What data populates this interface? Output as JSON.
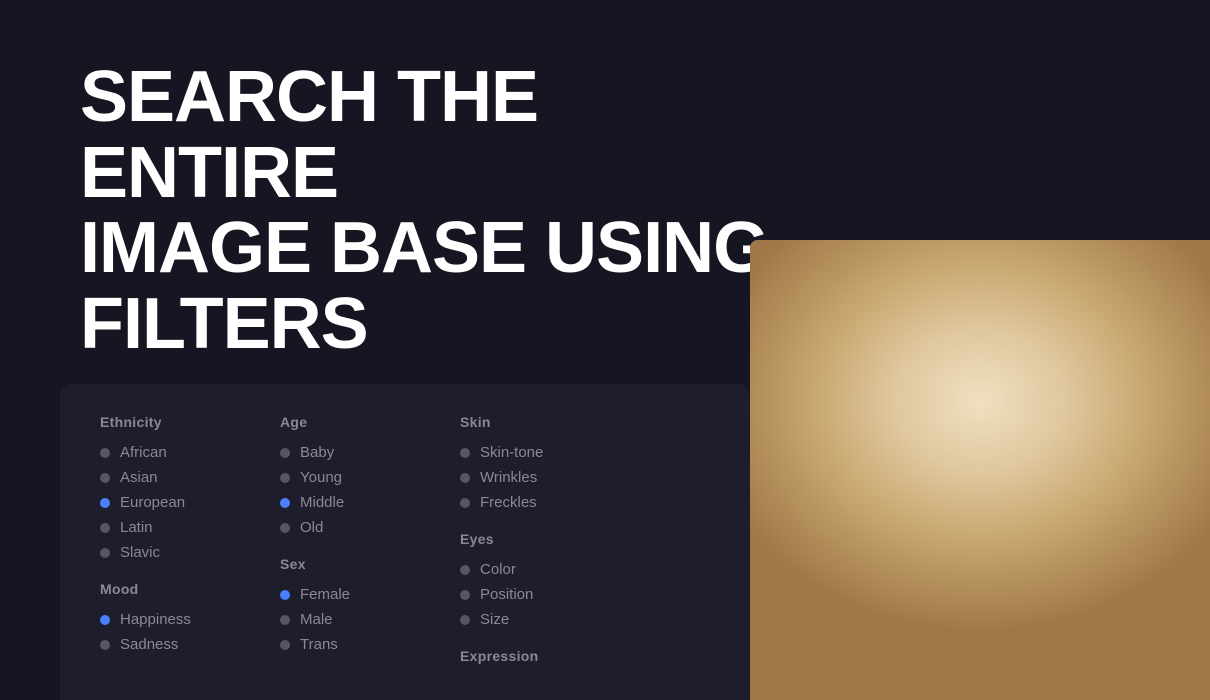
{
  "hero": {
    "title_line1": "SEARCH THE ENTIRE",
    "title_line2": "IMAGE BASE USING",
    "title_line3": "FILTERS"
  },
  "filters": {
    "columns": [
      {
        "id": "col1",
        "groups": [
          {
            "id": "ethnicity",
            "label": "Ethnicity",
            "items": [
              {
                "id": "african",
                "label": "African",
                "active": false
              },
              {
                "id": "asian",
                "label": "Asian",
                "active": false
              },
              {
                "id": "european",
                "label": "European",
                "active": true
              },
              {
                "id": "latin",
                "label": "Latin",
                "active": false
              },
              {
                "id": "slavic",
                "label": "Slavic",
                "active": false
              }
            ]
          },
          {
            "id": "mood",
            "label": "Mood",
            "items": [
              {
                "id": "happiness",
                "label": "Happiness",
                "active": true
              },
              {
                "id": "sadness",
                "label": "Sadness",
                "active": false
              }
            ]
          }
        ]
      },
      {
        "id": "col2",
        "groups": [
          {
            "id": "age",
            "label": "Age",
            "items": [
              {
                "id": "baby",
                "label": "Baby",
                "active": false
              },
              {
                "id": "young",
                "label": "Young",
                "active": false
              },
              {
                "id": "middle",
                "label": "Middle",
                "active": true
              },
              {
                "id": "old",
                "label": "Old",
                "active": false
              }
            ]
          },
          {
            "id": "sex",
            "label": "Sex",
            "items": [
              {
                "id": "female",
                "label": "Female",
                "active": true
              },
              {
                "id": "male",
                "label": "Male",
                "active": false
              },
              {
                "id": "trans",
                "label": "Trans",
                "active": false
              }
            ]
          }
        ]
      },
      {
        "id": "col3",
        "groups": [
          {
            "id": "skin",
            "label": "Skin",
            "items": [
              {
                "id": "skin-tone",
                "label": "Skin-tone",
                "active": false
              },
              {
                "id": "wrinkles",
                "label": "Wrinkles",
                "active": false
              },
              {
                "id": "freckles",
                "label": "Freckles",
                "active": false
              }
            ]
          },
          {
            "id": "eyes",
            "label": "Eyes",
            "items": [
              {
                "id": "color",
                "label": "Color",
                "active": false
              },
              {
                "id": "position",
                "label": "Position",
                "active": false
              },
              {
                "id": "size",
                "label": "Size",
                "active": false
              }
            ]
          },
          {
            "id": "expression",
            "label": "Expression",
            "items": []
          }
        ]
      }
    ]
  }
}
